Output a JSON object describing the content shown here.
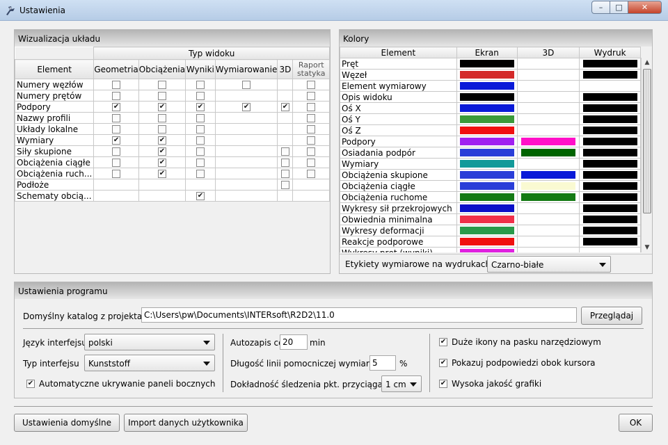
{
  "window": {
    "title": "Ustawienia",
    "min": "–",
    "max": "□",
    "close": "✕"
  },
  "viz": {
    "title": "Wizualizacja układu",
    "group_header": "Typ widoku",
    "element_header": "Element",
    "columns": [
      "Geometria",
      "Obciążenia",
      "Wyniki",
      "Wymiarowanie",
      "3D",
      "Raport statyka"
    ],
    "rows": [
      {
        "label": "Numery węzłów",
        "cells": [
          0,
          0,
          0,
          0,
          -1,
          0
        ]
      },
      {
        "label": "Numery prętów",
        "cells": [
          0,
          0,
          0,
          -1,
          -1,
          0
        ]
      },
      {
        "label": "Podpory",
        "cells": [
          1,
          1,
          1,
          1,
          1,
          0
        ]
      },
      {
        "label": "Nazwy profili",
        "cells": [
          0,
          0,
          0,
          -1,
          -1,
          0
        ]
      },
      {
        "label": "Układy lokalne",
        "cells": [
          0,
          0,
          0,
          -1,
          -1,
          0
        ]
      },
      {
        "label": "Wymiary",
        "cells": [
          1,
          1,
          0,
          -1,
          -1,
          0
        ]
      },
      {
        "label": "Siły skupione",
        "cells": [
          0,
          1,
          0,
          -1,
          0,
          0
        ]
      },
      {
        "label": "Obciążenia ciągłe",
        "cells": [
          0,
          1,
          0,
          -1,
          0,
          0
        ]
      },
      {
        "label": "Obciążenia ruch...",
        "cells": [
          0,
          1,
          0,
          -1,
          0,
          0
        ]
      },
      {
        "label": "Podłoże",
        "cells": [
          -1,
          -1,
          -1,
          -1,
          0,
          -1
        ]
      },
      {
        "label": "Schematy obcią...",
        "cells": [
          -1,
          -1,
          1,
          -1,
          -1,
          -1
        ]
      }
    ]
  },
  "colors": {
    "title": "Kolory",
    "headers": [
      "Element",
      "Ekran",
      "3D",
      "Wydruk"
    ],
    "rows": [
      {
        "label": "Pręt",
        "ekran": "#000000",
        "d3": null,
        "wydruk": "#000000"
      },
      {
        "label": "Węzeł",
        "ekran": "#d42a2a",
        "d3": null,
        "wydruk": "#000000"
      },
      {
        "label": "Element wymiarowy",
        "ekran": "#0a1ad8",
        "d3": null,
        "wydruk": null
      },
      {
        "label": "Opis widoku",
        "ekran": "#000000",
        "d3": null,
        "wydruk": "#000000"
      },
      {
        "label": "Oś X",
        "ekran": "#0a1ad8",
        "d3": null,
        "wydruk": "#000000"
      },
      {
        "label": "Oś Y",
        "ekran": "#3a9a3a",
        "d3": null,
        "wydruk": "#000000"
      },
      {
        "label": "Oś Z",
        "ekran": "#f01010",
        "d3": null,
        "wydruk": "#000000"
      },
      {
        "label": "Podpory",
        "ekran": "#a020f0",
        "d3": "#ff10c8",
        "wydruk": "#000000"
      },
      {
        "label": "Osiadania podpór",
        "ekran": "#2a3ed8",
        "d3": "#006400",
        "wydruk": "#000000"
      },
      {
        "label": "Wymiary",
        "ekran": "#129a9a",
        "d3": null,
        "wydruk": "#000000"
      },
      {
        "label": "Obciążenia skupione",
        "ekran": "#2a3ed8",
        "d3": "#0a1ad8",
        "wydruk": "#000000"
      },
      {
        "label": "Obciążenia ciągłe",
        "ekran": "#2a3ed8",
        "d3": "#fafad2",
        "wydruk": "#000000"
      },
      {
        "label": "Obciążenia ruchome",
        "ekran": "#157a15",
        "d3": "#157a15",
        "wydruk": "#000000"
      },
      {
        "label": "Wykresy sił przekrojowych",
        "ekran": "#0a10c8",
        "d3": null,
        "wydruk": "#000000"
      },
      {
        "label": "Obwiednia minimalna",
        "ekran": "#f0304a",
        "d3": null,
        "wydruk": "#000000"
      },
      {
        "label": "Wykresy deformacji",
        "ekran": "#2a9a4a",
        "d3": null,
        "wydruk": "#000000"
      },
      {
        "label": "Reakcje podporowe",
        "ekran": "#f01010",
        "d3": null,
        "wydruk": "#000000"
      },
      {
        "label": "Wykresy pręt (wyniki)",
        "ekran": "#e020e0",
        "d3": null,
        "wydruk": null
      }
    ],
    "etykiety_label": "Etykiety wymiarowe na wydrukach:",
    "etykiety_value": "Czarno-białe"
  },
  "program": {
    "title": "Ustawienia programu",
    "catalog_label": "Domyślny katalog z projektami",
    "catalog_value": "C:\\Users\\pw\\Documents\\INTERsoft\\R2D2\\11.0",
    "browse": "Przeglądaj",
    "lang_label": "Język interfejsu",
    "lang_value": "polski",
    "type_label": "Typ interfejsu",
    "type_value": "Kunststoff",
    "auto_hide": "Automatyczne ukrywanie paneli bocznych",
    "autosave_label": "Autozapis co",
    "autosave_value": "20",
    "autosave_unit": "min",
    "line_label": "Długość linii pomocniczej wymiarów",
    "line_value": "5",
    "line_unit": "%",
    "snap_label": "Dokładność śledzenia pkt. przyciągania",
    "snap_value": "1 cm",
    "big_icons": "Duże ikony na pasku narzędziowym",
    "tooltips": "Pokazuj podpowiedzi obok kursora",
    "hq": "Wysoka jakość grafiki"
  },
  "footer": {
    "defaults": "Ustawienia domyślne",
    "import": "Import danych użytkownika",
    "ok": "OK"
  },
  "check_glyph": "✔"
}
